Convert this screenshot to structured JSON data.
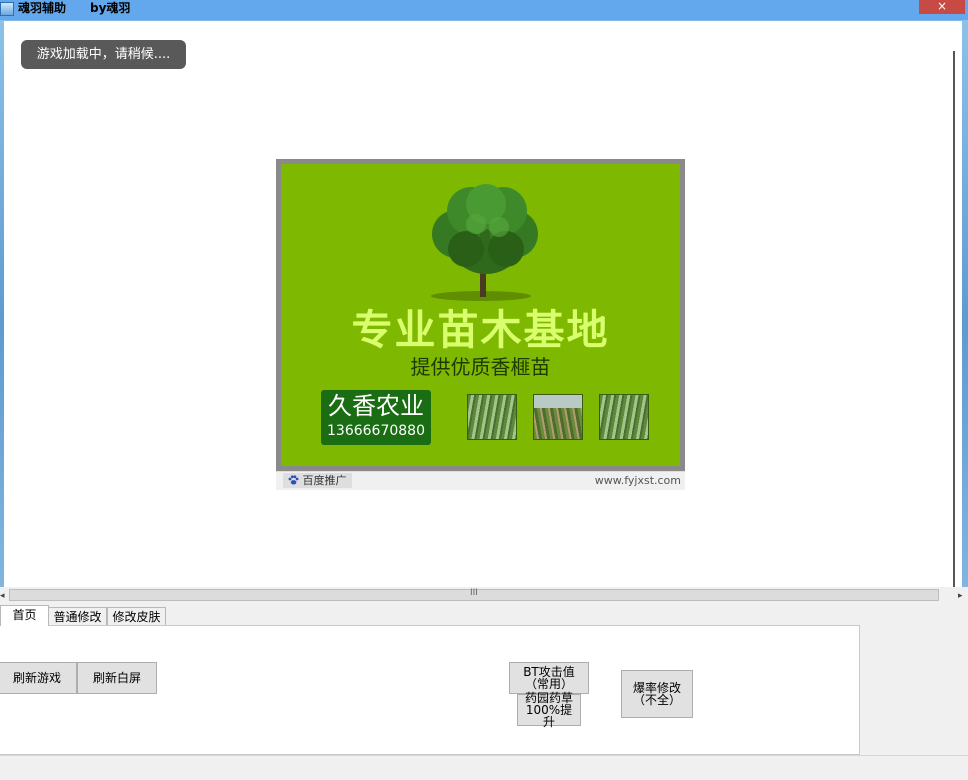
{
  "window": {
    "title": "魂羽辅助",
    "author": "by魂羽",
    "close_symbol": "×"
  },
  "webview": {
    "loading_toast": "游戏加载中，请稍候....",
    "ad": {
      "headline": "专业苗木基地",
      "subline": "提供优质香榧苗",
      "brand_name": "久香农业",
      "brand_phone": "13666670880",
      "badge": "百度推广",
      "url": "www.fyjxst.com"
    }
  },
  "hscroll": {
    "left_arrow": "◂",
    "right_arrow": "▸",
    "grip": "III"
  },
  "tabs": [
    {
      "label": "首页",
      "active": true
    },
    {
      "label": "普通修改",
      "active": false
    },
    {
      "label": "修改皮肤",
      "active": false
    }
  ],
  "buttons": {
    "refresh_game": "刷新游戏",
    "refresh_white": "刷新白屏",
    "bt_attack": "BT攻击值（常用）",
    "herb": "药园药草100%提升",
    "drop_rate": "爆率修改（不全）"
  },
  "colors": {
    "titlebar": "#63a7ec",
    "close": "#c84a44",
    "ad_green": "#7fb800",
    "headline": "#d9ff6e",
    "brand_box": "#1a6d12"
  }
}
